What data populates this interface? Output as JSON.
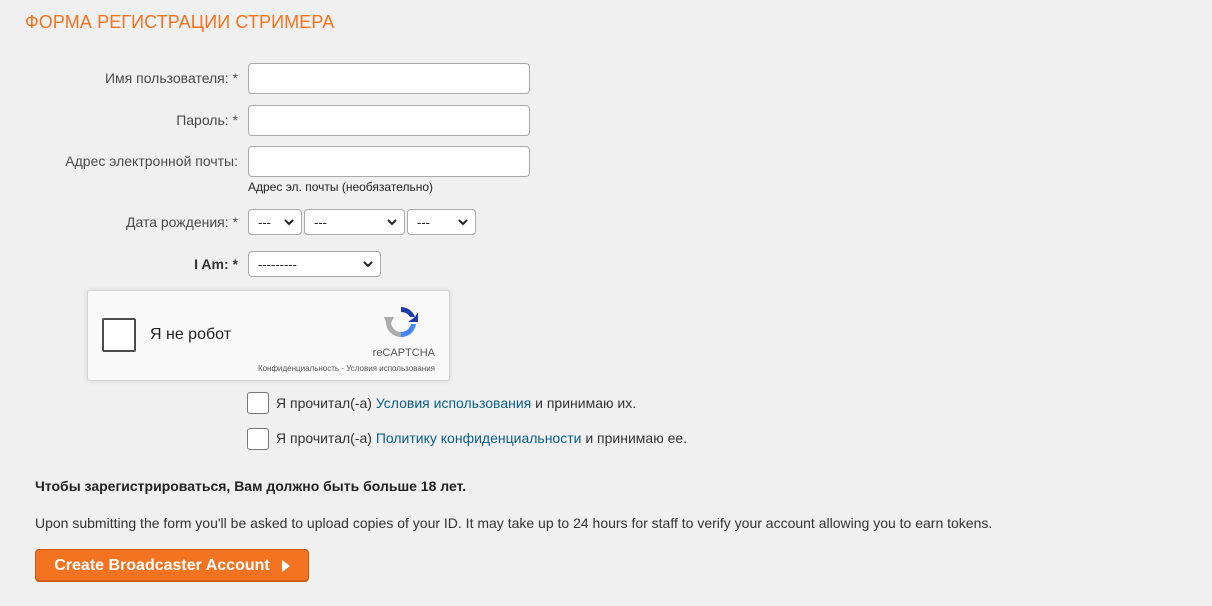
{
  "page": {
    "title": "ФОРМА РЕГИСТРАЦИИ СТРИМЕРА"
  },
  "fields": {
    "username": {
      "label": "Имя пользователя: *",
      "value": ""
    },
    "password": {
      "label": "Пароль: *",
      "value": ""
    },
    "email": {
      "label": "Адрес электронной почты:",
      "value": "",
      "hint": "Адрес эл. почты (необязательно)"
    },
    "birthdate": {
      "label": "Дата рождения: *",
      "day": "---",
      "month": "---",
      "year": "---"
    },
    "i_am": {
      "label": "I Am: *",
      "value": "---------"
    }
  },
  "captcha": {
    "label": "Я не робот",
    "brand": "reCAPTCHA",
    "links": "Конфиденциальность - Условия использования"
  },
  "agreements": {
    "terms": {
      "prefix": "Я прочитал(-а) ",
      "link": "Условия использования",
      "suffix": " и принимаю их."
    },
    "privacy": {
      "prefix": "Я прочитал(-а) ",
      "link": "Политику конфиденциальности",
      "suffix": " и принимаю ее."
    }
  },
  "notes": {
    "age": "Чтобы зарегистрироваться, Вам должно быть больше 18 лет.",
    "id": "Upon submitting the form you'll be asked to upload copies of your ID. It may take up to 24 hours for staff to verify your account allowing you to earn tokens."
  },
  "submit": {
    "label": "Create Broadcaster Account"
  },
  "colors": {
    "accent": "#f47321",
    "link": "#0b5f8a",
    "background": "#f0f0f0"
  }
}
